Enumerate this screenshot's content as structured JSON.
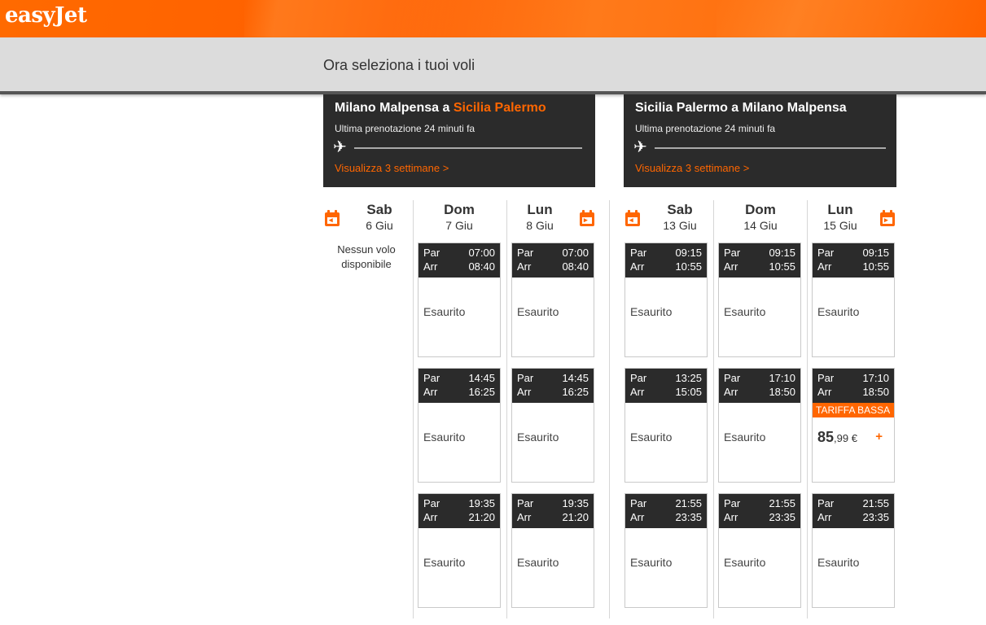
{
  "brand": {
    "logo_text": "easyJet",
    "accent": "#ff6600",
    "panel": "#2b2b2b"
  },
  "header": {
    "title": "Ora seleziona i tuoi voli"
  },
  "outbound": {
    "from": "Milano Malpensa",
    "connector": " a ",
    "to": "Sicilia Palermo",
    "last_booking": "Ultima prenotazione 24 minuti fa",
    "weeks_link": "Visualizza 3 settimane >",
    "days": [
      {
        "name": "Sab",
        "date": "6 Giu",
        "no_flight": "Nessun volo disponibile",
        "flights": []
      },
      {
        "name": "Dom",
        "date": "7 Giu",
        "flights": [
          {
            "dep_label": "Par",
            "dep": "07:00",
            "arr_label": "Arr",
            "arr": "08:40",
            "status": "Esaurito"
          },
          {
            "dep_label": "Par",
            "dep": "14:45",
            "arr_label": "Arr",
            "arr": "16:25",
            "status": "Esaurito"
          },
          {
            "dep_label": "Par",
            "dep": "19:35",
            "arr_label": "Arr",
            "arr": "21:20",
            "status": "Esaurito"
          }
        ]
      },
      {
        "name": "Lun",
        "date": "8 Giu",
        "flights": [
          {
            "dep_label": "Par",
            "dep": "07:00",
            "arr_label": "Arr",
            "arr": "08:40",
            "status": "Esaurito"
          },
          {
            "dep_label": "Par",
            "dep": "14:45",
            "arr_label": "Arr",
            "arr": "16:25",
            "status": "Esaurito"
          },
          {
            "dep_label": "Par",
            "dep": "19:35",
            "arr_label": "Arr",
            "arr": "21:20",
            "status": "Esaurito"
          }
        ]
      }
    ]
  },
  "inbound": {
    "title": "Sicilia Palermo a Milano Malpensa",
    "last_booking": "Ultima prenotazione 24 minuti fa",
    "weeks_link": "Visualizza 3 settimane >",
    "days": [
      {
        "name": "Sab",
        "date": "13 Giu",
        "flights": [
          {
            "dep_label": "Par",
            "dep": "09:15",
            "arr_label": "Arr",
            "arr": "10:55",
            "status": "Esaurito"
          },
          {
            "dep_label": "Par",
            "dep": "13:25",
            "arr_label": "Arr",
            "arr": "15:05",
            "status": "Esaurito"
          },
          {
            "dep_label": "Par",
            "dep": "21:55",
            "arr_label": "Arr",
            "arr": "23:35",
            "status": "Esaurito"
          }
        ]
      },
      {
        "name": "Dom",
        "date": "14 Giu",
        "flights": [
          {
            "dep_label": "Par",
            "dep": "09:15",
            "arr_label": "Arr",
            "arr": "10:55",
            "status": "Esaurito"
          },
          {
            "dep_label": "Par",
            "dep": "17:10",
            "arr_label": "Arr",
            "arr": "18:50",
            "status": "Esaurito"
          },
          {
            "dep_label": "Par",
            "dep": "21:55",
            "arr_label": "Arr",
            "arr": "23:35",
            "status": "Esaurito"
          }
        ]
      },
      {
        "name": "Lun",
        "date": "15 Giu",
        "flights": [
          {
            "dep_label": "Par",
            "dep": "09:15",
            "arr_label": "Arr",
            "arr": "10:55",
            "status": "Esaurito"
          },
          {
            "dep_label": "Par",
            "dep": "17:10",
            "arr_label": "Arr",
            "arr": "18:50",
            "badge": "TARIFFA BASSA",
            "price_int": "85",
            "price_dec": ",99 €",
            "add": "+"
          },
          {
            "dep_label": "Par",
            "dep": "21:55",
            "arr_label": "Arr",
            "arr": "23:35",
            "status": "Esaurito"
          }
        ]
      }
    ]
  }
}
